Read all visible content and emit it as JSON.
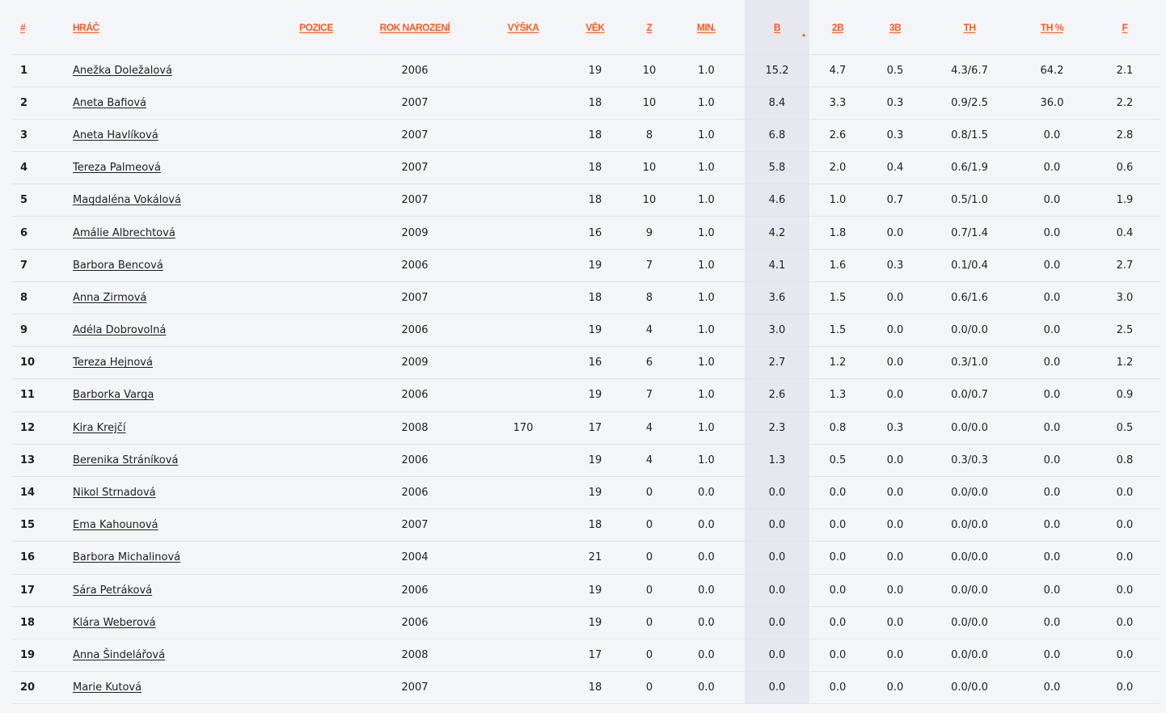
{
  "table": {
    "headers": {
      "rank": "#",
      "player": "HRÁČ",
      "position": "POZICE",
      "birth_year": "ROK NAROZENÍ",
      "height": "VÝŠKA",
      "age": "VĚK",
      "games": "Z",
      "minutes": "MIN.",
      "points": "B",
      "two_pt": "2B",
      "three_pt": "3B",
      "free_throws": "TH",
      "ft_pct": "TH %",
      "fouls": "F"
    },
    "sort_indicator": "▲",
    "rows": [
      {
        "rank": "1",
        "name": "Anežka Doležalová",
        "position": "",
        "birth_year": "2006",
        "height": "",
        "age": "19",
        "games": "10",
        "minutes": "1.0",
        "points": "15.2",
        "two_pt": "4.7",
        "three_pt": "0.5",
        "ft": "4.3/6.7",
        "ft_pct": "64.2",
        "fouls": "2.1"
      },
      {
        "rank": "2",
        "name": "Aneta Bafiová",
        "position": "",
        "birth_year": "2007",
        "height": "",
        "age": "18",
        "games": "10",
        "minutes": "1.0",
        "points": "8.4",
        "two_pt": "3.3",
        "three_pt": "0.3",
        "ft": "0.9/2.5",
        "ft_pct": "36.0",
        "fouls": "2.2"
      },
      {
        "rank": "3",
        "name": "Aneta Havlíková",
        "position": "",
        "birth_year": "2007",
        "height": "",
        "age": "18",
        "games": "8",
        "minutes": "1.0",
        "points": "6.8",
        "two_pt": "2.6",
        "three_pt": "0.3",
        "ft": "0.8/1.5",
        "ft_pct": "0.0",
        "fouls": "2.8"
      },
      {
        "rank": "4",
        "name": "Tereza Palmeová",
        "position": "",
        "birth_year": "2007",
        "height": "",
        "age": "18",
        "games": "10",
        "minutes": "1.0",
        "points": "5.8",
        "two_pt": "2.0",
        "three_pt": "0.4",
        "ft": "0.6/1.9",
        "ft_pct": "0.0",
        "fouls": "0.6"
      },
      {
        "rank": "5",
        "name": "Magdaléna Vokálová",
        "position": "",
        "birth_year": "2007",
        "height": "",
        "age": "18",
        "games": "10",
        "minutes": "1.0",
        "points": "4.6",
        "two_pt": "1.0",
        "three_pt": "0.7",
        "ft": "0.5/1.0",
        "ft_pct": "0.0",
        "fouls": "1.9"
      },
      {
        "rank": "6",
        "name": "Amálie Albrechtová",
        "position": "",
        "birth_year": "2009",
        "height": "",
        "age": "16",
        "games": "9",
        "minutes": "1.0",
        "points": "4.2",
        "two_pt": "1.8",
        "three_pt": "0.0",
        "ft": "0.7/1.4",
        "ft_pct": "0.0",
        "fouls": "0.4"
      },
      {
        "rank": "7",
        "name": "Barbora Bencová",
        "position": "",
        "birth_year": "2006",
        "height": "",
        "age": "19",
        "games": "7",
        "minutes": "1.0",
        "points": "4.1",
        "two_pt": "1.6",
        "three_pt": "0.3",
        "ft": "0.1/0.4",
        "ft_pct": "0.0",
        "fouls": "2.7"
      },
      {
        "rank": "8",
        "name": "Anna Zirmová",
        "position": "",
        "birth_year": "2007",
        "height": "",
        "age": "18",
        "games": "8",
        "minutes": "1.0",
        "points": "3.6",
        "two_pt": "1.5",
        "three_pt": "0.0",
        "ft": "0.6/1.6",
        "ft_pct": "0.0",
        "fouls": "3.0"
      },
      {
        "rank": "9",
        "name": "Adéla Dobrovolná",
        "position": "",
        "birth_year": "2006",
        "height": "",
        "age": "19",
        "games": "4",
        "minutes": "1.0",
        "points": "3.0",
        "two_pt": "1.5",
        "three_pt": "0.0",
        "ft": "0.0/0.0",
        "ft_pct": "0.0",
        "fouls": "2.5"
      },
      {
        "rank": "10",
        "name": "Tereza Hejnová",
        "position": "",
        "birth_year": "2009",
        "height": "",
        "age": "16",
        "games": "6",
        "minutes": "1.0",
        "points": "2.7",
        "two_pt": "1.2",
        "three_pt": "0.0",
        "ft": "0.3/1.0",
        "ft_pct": "0.0",
        "fouls": "1.2"
      },
      {
        "rank": "11",
        "name": "Barborka Varga",
        "position": "",
        "birth_year": "2006",
        "height": "",
        "age": "19",
        "games": "7",
        "minutes": "1.0",
        "points": "2.6",
        "two_pt": "1.3",
        "three_pt": "0.0",
        "ft": "0.0/0.7",
        "ft_pct": "0.0",
        "fouls": "0.9"
      },
      {
        "rank": "12",
        "name": "Kira Krejčí",
        "position": "",
        "birth_year": "2008",
        "height": "170",
        "age": "17",
        "games": "4",
        "minutes": "1.0",
        "points": "2.3",
        "two_pt": "0.8",
        "three_pt": "0.3",
        "ft": "0.0/0.0",
        "ft_pct": "0.0",
        "fouls": "0.5"
      },
      {
        "rank": "13",
        "name": "Berenika Stráníková",
        "position": "",
        "birth_year": "2006",
        "height": "",
        "age": "19",
        "games": "4",
        "minutes": "1.0",
        "points": "1.3",
        "two_pt": "0.5",
        "three_pt": "0.0",
        "ft": "0.3/0.3",
        "ft_pct": "0.0",
        "fouls": "0.8"
      },
      {
        "rank": "14",
        "name": "Nikol Strnadová",
        "position": "",
        "birth_year": "2006",
        "height": "",
        "age": "19",
        "games": "0",
        "minutes": "0.0",
        "points": "0.0",
        "two_pt": "0.0",
        "three_pt": "0.0",
        "ft": "0.0/0.0",
        "ft_pct": "0.0",
        "fouls": "0.0"
      },
      {
        "rank": "15",
        "name": "Ema Kahounová",
        "position": "",
        "birth_year": "2007",
        "height": "",
        "age": "18",
        "games": "0",
        "minutes": "0.0",
        "points": "0.0",
        "two_pt": "0.0",
        "three_pt": "0.0",
        "ft": "0.0/0.0",
        "ft_pct": "0.0",
        "fouls": "0.0"
      },
      {
        "rank": "16",
        "name": "Barbora Michalinová",
        "position": "",
        "birth_year": "2004",
        "height": "",
        "age": "21",
        "games": "0",
        "minutes": "0.0",
        "points": "0.0",
        "two_pt": "0.0",
        "three_pt": "0.0",
        "ft": "0.0/0.0",
        "ft_pct": "0.0",
        "fouls": "0.0"
      },
      {
        "rank": "17",
        "name": "Sára Petráková",
        "position": "",
        "birth_year": "2006",
        "height": "",
        "age": "19",
        "games": "0",
        "minutes": "0.0",
        "points": "0.0",
        "two_pt": "0.0",
        "three_pt": "0.0",
        "ft": "0.0/0.0",
        "ft_pct": "0.0",
        "fouls": "0.0"
      },
      {
        "rank": "18",
        "name": "Klára Weberová",
        "position": "",
        "birth_year": "2006",
        "height": "",
        "age": "19",
        "games": "0",
        "minutes": "0.0",
        "points": "0.0",
        "two_pt": "0.0",
        "three_pt": "0.0",
        "ft": "0.0/0.0",
        "ft_pct": "0.0",
        "fouls": "0.0"
      },
      {
        "rank": "19",
        "name": "Anna Šindelářová",
        "position": "",
        "birth_year": "2008",
        "height": "",
        "age": "17",
        "games": "0",
        "minutes": "0.0",
        "points": "0.0",
        "two_pt": "0.0",
        "three_pt": "0.0",
        "ft": "0.0/0.0",
        "ft_pct": "0.0",
        "fouls": "0.0"
      },
      {
        "rank": "20",
        "name": "Marie Kutová",
        "position": "",
        "birth_year": "2007",
        "height": "",
        "age": "18",
        "games": "0",
        "minutes": "0.0",
        "points": "0.0",
        "two_pt": "0.0",
        "three_pt": "0.0",
        "ft": "0.0/0.0",
        "ft_pct": "0.0",
        "fouls": "0.0"
      }
    ]
  },
  "colors": {
    "accent": "#ff5a1f",
    "background": "#f4f5f9",
    "sorted_column": "#e6e7ef",
    "text": "#1e1e1e"
  }
}
